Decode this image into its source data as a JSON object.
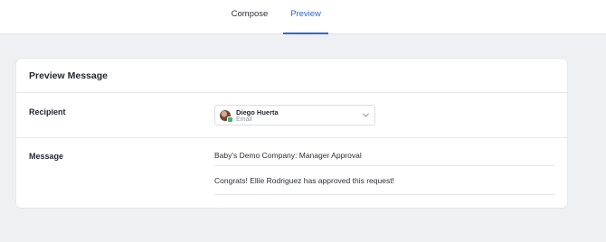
{
  "tabs": {
    "compose": "Compose",
    "preview": "Preview",
    "active": "Preview"
  },
  "card": {
    "title": "Preview Message",
    "recipient_label": "Recipient",
    "message_label": "Message"
  },
  "recipient": {
    "name": "Diego Huerta",
    "type": "Email",
    "icon": "chevron-down-icon"
  },
  "message": {
    "subject": "Baby's Demo Company: Manager Approval",
    "body": "Congrats! Ellie Rodriguez has approved this request!"
  },
  "colors": {
    "accent": "#2f66d0",
    "background": "#eef0f3",
    "card": "#ffffff"
  }
}
